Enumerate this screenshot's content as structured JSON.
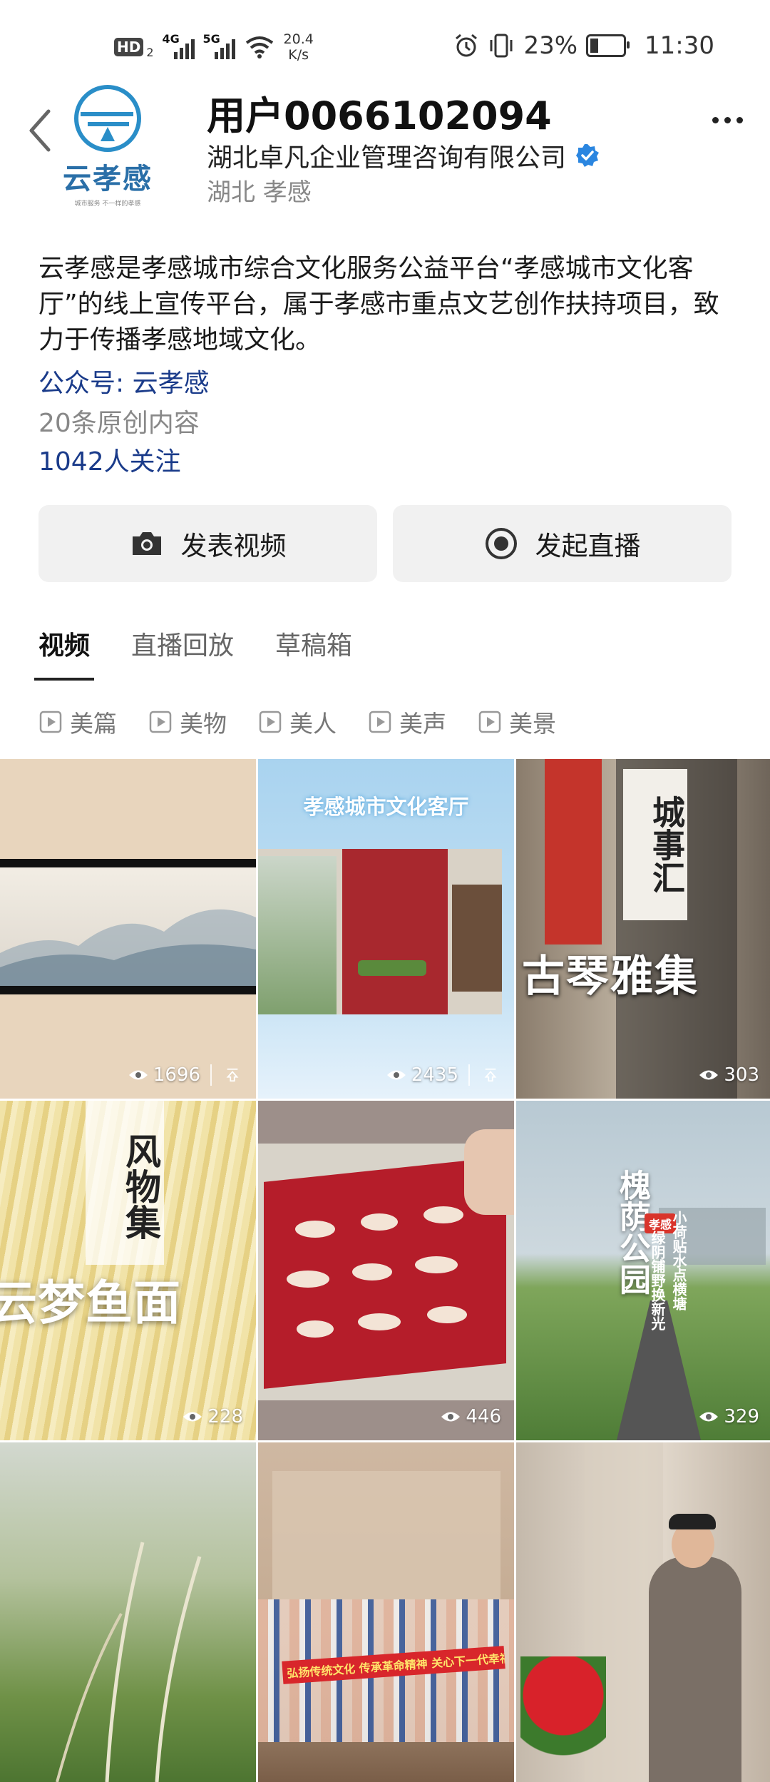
{
  "status_bar": {
    "hd": "HD",
    "sim_badge": "2",
    "net1": "4G",
    "net2": "5G",
    "speed_value": "20.4",
    "speed_unit": "K/s",
    "battery_pct": "23%",
    "time": "11:30"
  },
  "profile": {
    "logo_name": "云孝感",
    "logo_slogan": "城市服务 不一样的孝感",
    "user_name": "用户0066102094",
    "company": "湖北卓凡企业管理咨询有限公司",
    "region": "湖北 孝感",
    "intro": "云孝感是孝感城市综合文化服务公益平台“孝感城市文化客厅”的线上宣传平台，属于孝感市重点文艺创作扶持项目，致力于传播孝感地域文化。",
    "wechat": "公众号: 云孝感",
    "original_count": "20条原创内容",
    "followers": "1042人关注"
  },
  "actions": {
    "post_video": "发表视频",
    "start_live": "发起直播"
  },
  "tabs": [
    "视频",
    "直播回放",
    "草稿箱"
  ],
  "filters": [
    "美篇",
    "美物",
    "美人",
    "美声",
    "美景"
  ],
  "videos": [
    {
      "views": "1696",
      "pinned": true,
      "caption": ""
    },
    {
      "views": "2435",
      "pinned": true,
      "caption": "孝感城市文化客厅"
    },
    {
      "views": "303",
      "pinned": false,
      "caption": "城事汇",
      "subcaption": "古琴雅集"
    },
    {
      "views": "228",
      "pinned": false,
      "caption": "风物集",
      "subcaption": "云梦鱼面"
    },
    {
      "views": "446",
      "pinned": false,
      "caption": ""
    },
    {
      "views": "329",
      "pinned": false,
      "caption": "槐荫公园",
      "subcaption": "绿阴铺野换新光",
      "tag": "孝感",
      "sub2": "小荷贴水点横塘"
    },
    {
      "views": "",
      "pinned": false,
      "caption": ""
    },
    {
      "views": "",
      "pinned": false,
      "caption": "弘扬传统文化 传承革命精神 关心下一代幸福成长"
    },
    {
      "views": "",
      "pinned": false,
      "caption": ""
    }
  ]
}
